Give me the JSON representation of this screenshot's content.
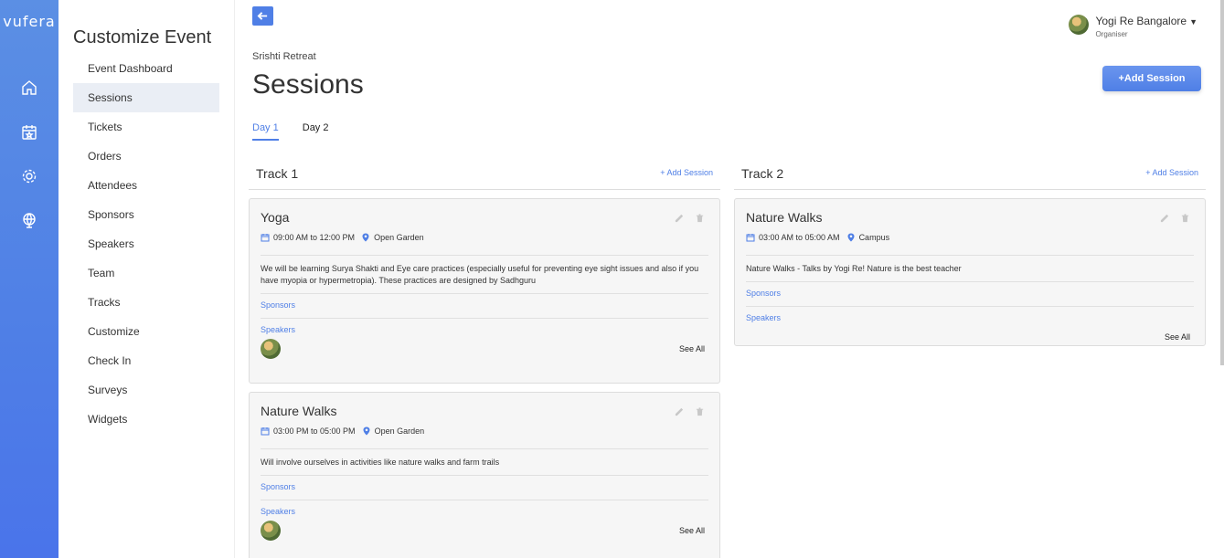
{
  "brand": "vufera",
  "sidebar": {
    "title": "Customize Event",
    "items": [
      {
        "label": "Event Dashboard"
      },
      {
        "label": "Sessions",
        "active": true
      },
      {
        "label": "Tickets"
      },
      {
        "label": "Orders"
      },
      {
        "label": "Attendees"
      },
      {
        "label": "Sponsors"
      },
      {
        "label": "Speakers"
      },
      {
        "label": "Team"
      },
      {
        "label": "Tracks"
      },
      {
        "label": "Customize"
      },
      {
        "label": "Check In"
      },
      {
        "label": "Surveys"
      },
      {
        "label": "Widgets"
      }
    ]
  },
  "rail_icons": [
    "home-icon",
    "calendar-star-icon",
    "settings-cog-icon",
    "globe-network-icon"
  ],
  "user": {
    "name": "Yogi Re Bangalore",
    "role": "Organiser"
  },
  "breadcrumb": "Srishti Retreat",
  "page_title": "Sessions",
  "add_session_button": "+Add Session",
  "tabs": [
    {
      "label": "Day 1",
      "active": true
    },
    {
      "label": "Day 2"
    }
  ],
  "tracks": [
    {
      "title": "Track 1",
      "add_label": "+ Add Session",
      "sessions": [
        {
          "title": "Yoga",
          "time": "09:00 AM to 12:00 PM",
          "location": "Open Garden",
          "description": "We will be learning Surya Shakti and Eye care practices (especially useful for preventing eye sight issues and also if you have myopia or hypermetropia). These practices are designed by Sadhguru",
          "sponsors_label": "Sponsors",
          "speakers_label": "Speakers",
          "see_all": "See All"
        },
        {
          "title": "Nature Walks",
          "time": "03:00 PM to 05:00 PM",
          "location": "Open Garden",
          "description": "Will involve ourselves in activities like nature walks and farm trails",
          "sponsors_label": "Sponsors",
          "speakers_label": "Speakers",
          "see_all": "See All"
        }
      ]
    },
    {
      "title": "Track 2",
      "add_label": "+ Add Session",
      "sessions": [
        {
          "title": "Nature Walks",
          "time": "03:00 AM to 05:00 AM",
          "location": "Campus",
          "description": "Nature Walks - Talks by Yogi Re! Nature is the best teacher",
          "sponsors_label": "Sponsors",
          "speakers_label": "Speakers",
          "see_all": "See All"
        }
      ]
    }
  ],
  "colors": {
    "accent": "#4f7fe6",
    "card_bg": "#f6f6f6"
  }
}
